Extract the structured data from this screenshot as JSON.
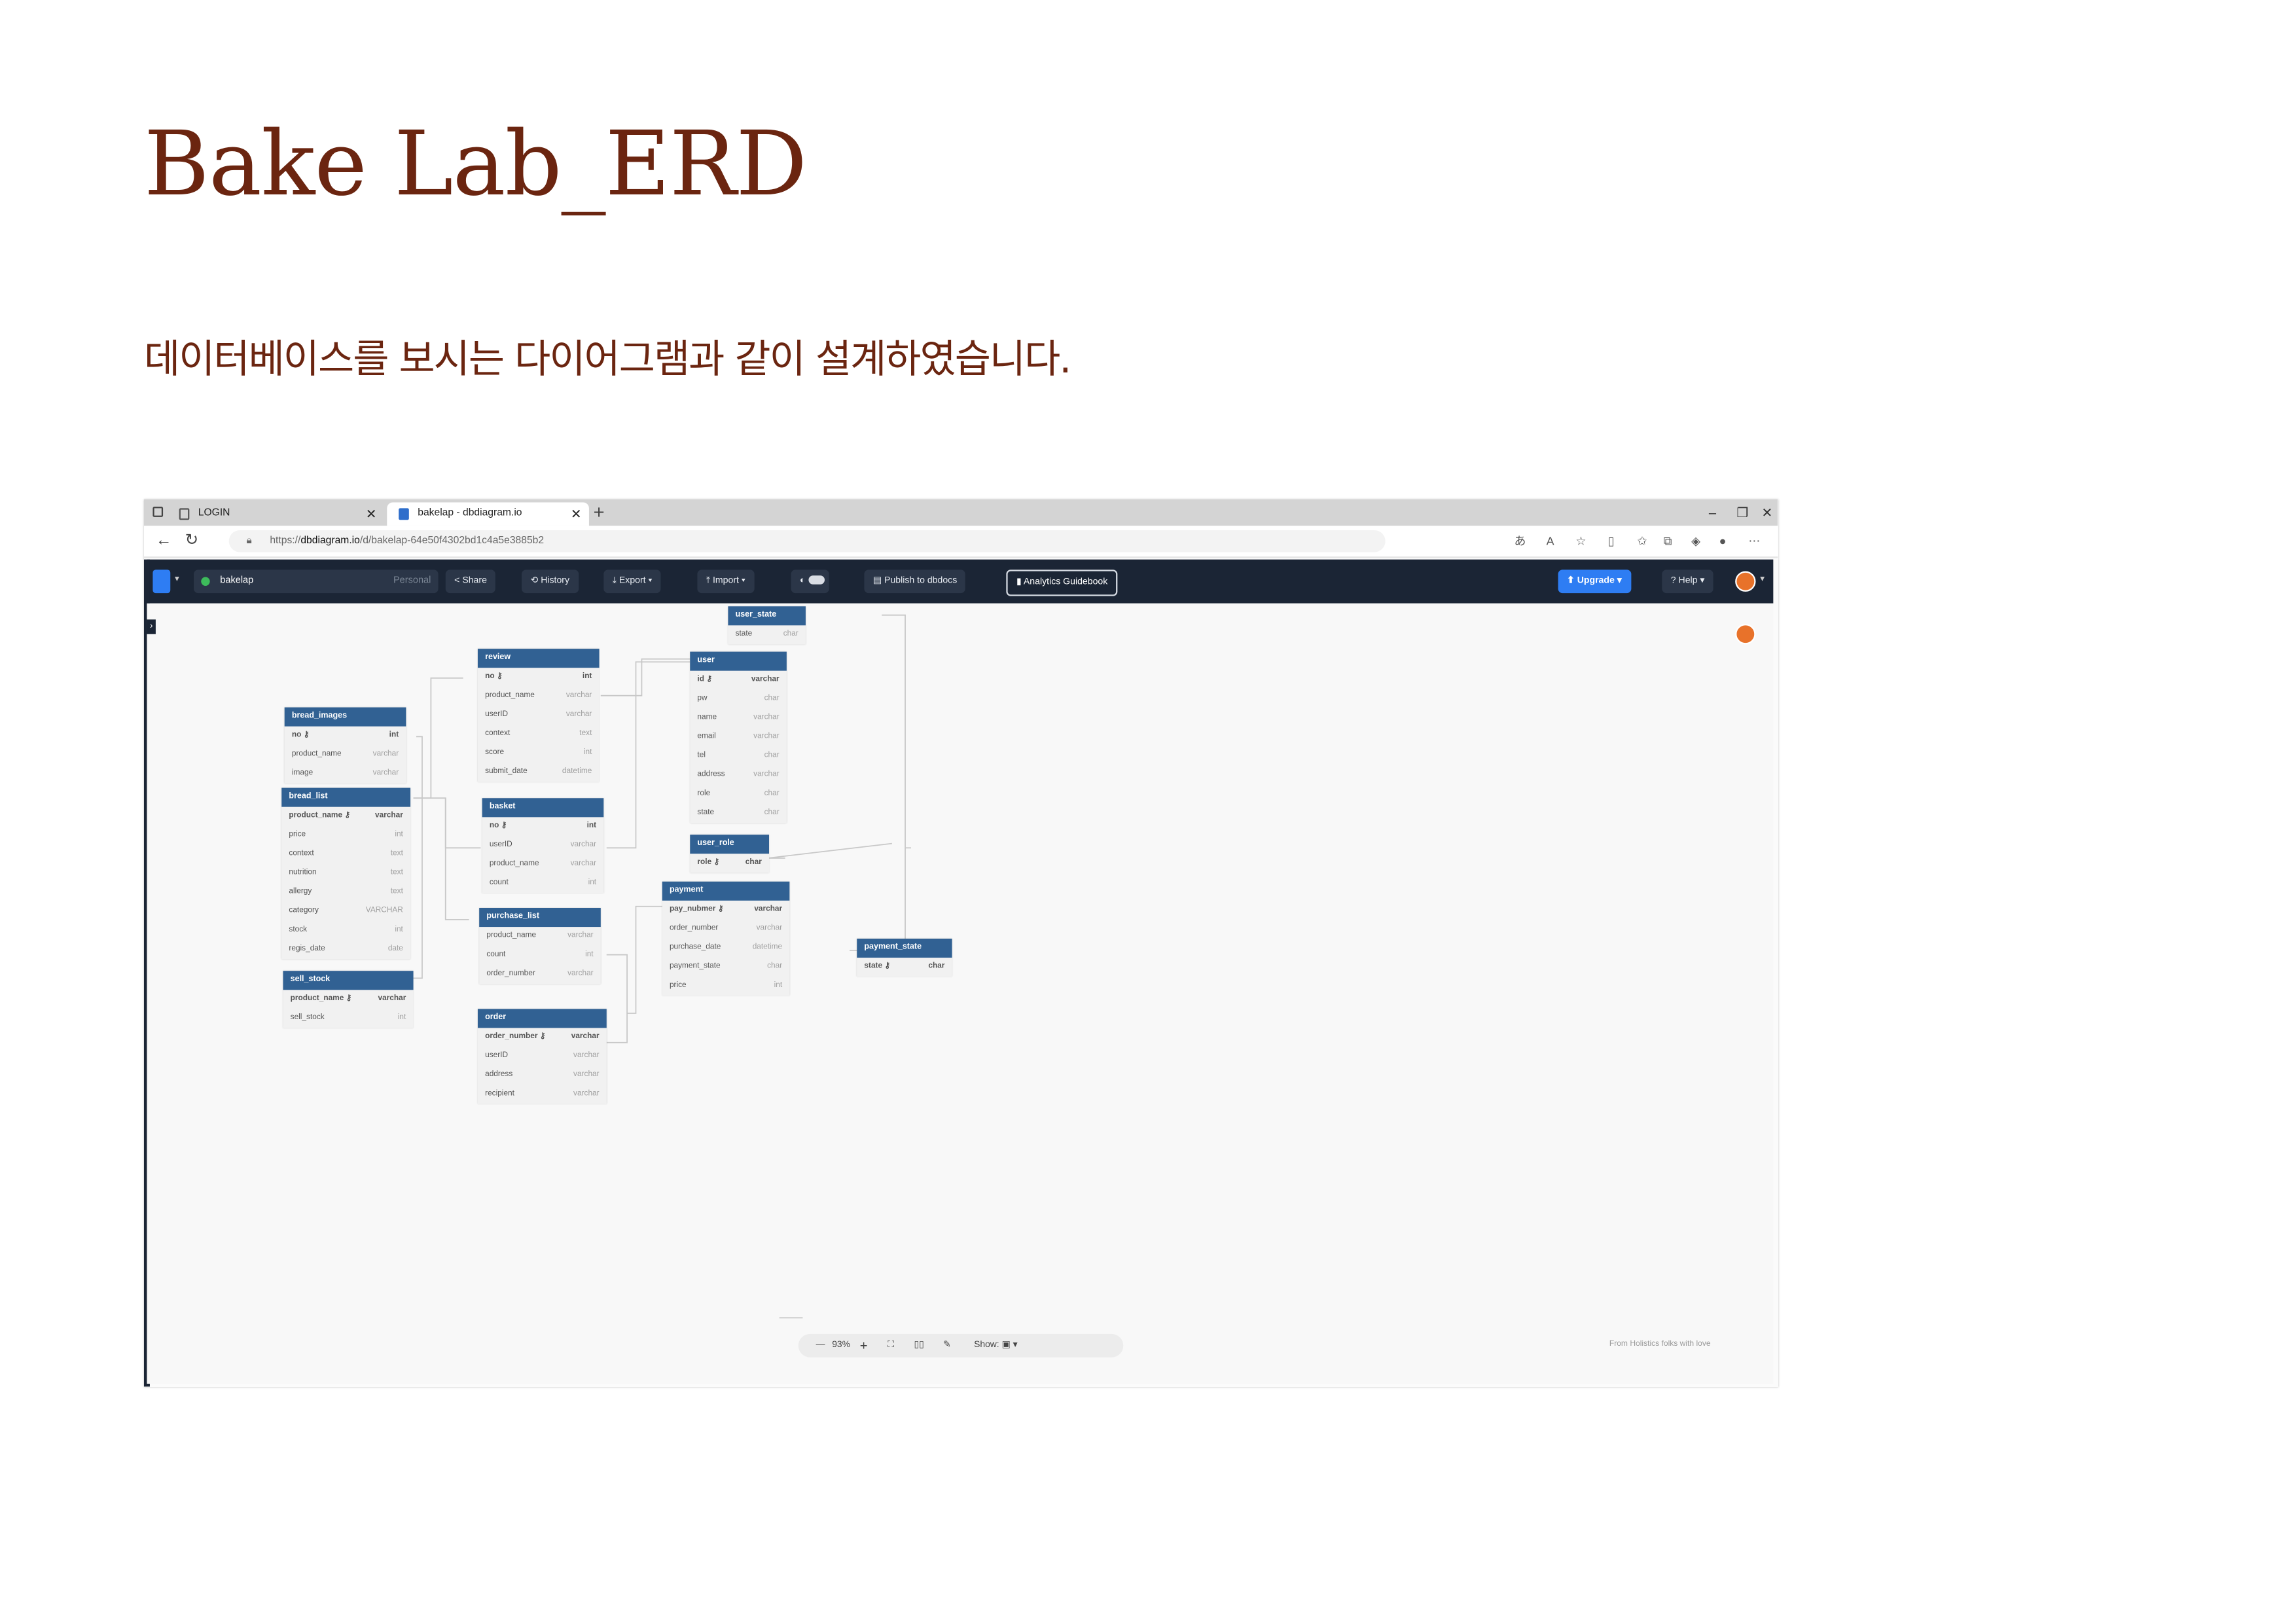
{
  "slide": {
    "title": "Bake Lab_ERD",
    "subtitle": "데이터베이스를 보시는 다이어그램과 같이 설계하였습니다."
  },
  "browser": {
    "tabs": [
      {
        "label": "LOGIN",
        "active": false
      },
      {
        "label": "bakelap - dbdiagram.io",
        "active": true
      }
    ],
    "url_prefix": "https://",
    "url_host": "dbdiagram.io",
    "url_path": "/d/bakelap-64e50f4302bd1c4a5e3885b2"
  },
  "app": {
    "project_name": "bakelap",
    "project_scope": "Personal",
    "share_label": "Share",
    "history_label": "History",
    "export_label": "Export",
    "import_label": "Import",
    "publish_label": "Publish to dbdocs",
    "analytics_label": "Analytics Guidebook",
    "upgrade_label": "Upgrade",
    "help_label": "Help",
    "accent_color": "#2e7df3",
    "header_color": "#316193"
  },
  "canvas": {
    "zoom": "93%",
    "show_label": "Show:",
    "footnote": "From Holistics folks with love"
  },
  "tables": [
    {
      "name": "user_state",
      "columns": [
        {
          "name": "state",
          "type": "char",
          "pk": false
        }
      ]
    },
    {
      "name": "review",
      "columns": [
        {
          "name": "no",
          "type": "int",
          "pk": true
        },
        {
          "name": "product_name",
          "type": "varchar",
          "pk": false
        },
        {
          "name": "userID",
          "type": "varchar",
          "pk": false
        },
        {
          "name": "context",
          "type": "text",
          "pk": false
        },
        {
          "name": "score",
          "type": "int",
          "pk": false
        },
        {
          "name": "submit_date",
          "type": "datetime",
          "pk": false
        }
      ]
    },
    {
      "name": "user",
      "columns": [
        {
          "name": "id",
          "type": "varchar",
          "pk": true
        },
        {
          "name": "pw",
          "type": "char",
          "pk": false
        },
        {
          "name": "name",
          "type": "varchar",
          "pk": false
        },
        {
          "name": "email",
          "type": "varchar",
          "pk": false
        },
        {
          "name": "tel",
          "type": "char",
          "pk": false
        },
        {
          "name": "address",
          "type": "varchar",
          "pk": false
        },
        {
          "name": "role",
          "type": "char",
          "pk": false
        },
        {
          "name": "state",
          "type": "char",
          "pk": false
        }
      ]
    },
    {
      "name": "bread_images",
      "columns": [
        {
          "name": "no",
          "type": "int",
          "pk": true
        },
        {
          "name": "product_name",
          "type": "varchar",
          "pk": false
        },
        {
          "name": "image",
          "type": "varchar",
          "pk": false
        }
      ]
    },
    {
      "name": "bread_list",
      "columns": [
        {
          "name": "product_name",
          "type": "varchar",
          "pk": true
        },
        {
          "name": "price",
          "type": "int",
          "pk": false
        },
        {
          "name": "context",
          "type": "text",
          "pk": false
        },
        {
          "name": "nutrition",
          "type": "text",
          "pk": false
        },
        {
          "name": "allergy",
          "type": "text",
          "pk": false
        },
        {
          "name": "category",
          "type": "VARCHAR",
          "pk": false
        },
        {
          "name": "stock",
          "type": "int",
          "pk": false
        },
        {
          "name": "regis_date",
          "type": "date",
          "pk": false
        }
      ]
    },
    {
      "name": "basket",
      "columns": [
        {
          "name": "no",
          "type": "int",
          "pk": true
        },
        {
          "name": "userID",
          "type": "varchar",
          "pk": false
        },
        {
          "name": "product_name",
          "type": "varchar",
          "pk": false
        },
        {
          "name": "count",
          "type": "int",
          "pk": false
        }
      ]
    },
    {
      "name": "user_role",
      "columns": [
        {
          "name": "role",
          "type": "char",
          "pk": true
        }
      ]
    },
    {
      "name": "payment",
      "columns": [
        {
          "name": "pay_nubmer",
          "type": "varchar",
          "pk": true
        },
        {
          "name": "order_number",
          "type": "varchar",
          "pk": false
        },
        {
          "name": "purchase_date",
          "type": "datetime",
          "pk": false
        },
        {
          "name": "payment_state",
          "type": "char",
          "pk": false
        },
        {
          "name": "price",
          "type": "int",
          "pk": false
        }
      ]
    },
    {
      "name": "purchase_list",
      "columns": [
        {
          "name": "product_name",
          "type": "varchar",
          "pk": false
        },
        {
          "name": "count",
          "type": "int",
          "pk": false
        },
        {
          "name": "order_number",
          "type": "varchar",
          "pk": false
        }
      ]
    },
    {
      "name": "payment_state",
      "columns": [
        {
          "name": "state",
          "type": "char",
          "pk": true
        }
      ]
    },
    {
      "name": "sell_stock",
      "columns": [
        {
          "name": "product_name",
          "type": "varchar",
          "pk": true
        },
        {
          "name": "sell_stock",
          "type": "int",
          "pk": false
        }
      ]
    },
    {
      "name": "order",
      "columns": [
        {
          "name": "order_number",
          "type": "varchar",
          "pk": true
        },
        {
          "name": "userID",
          "type": "varchar",
          "pk": false
        },
        {
          "name": "address",
          "type": "varchar",
          "pk": false
        },
        {
          "name": "recipient",
          "type": "varchar",
          "pk": false
        }
      ]
    }
  ]
}
